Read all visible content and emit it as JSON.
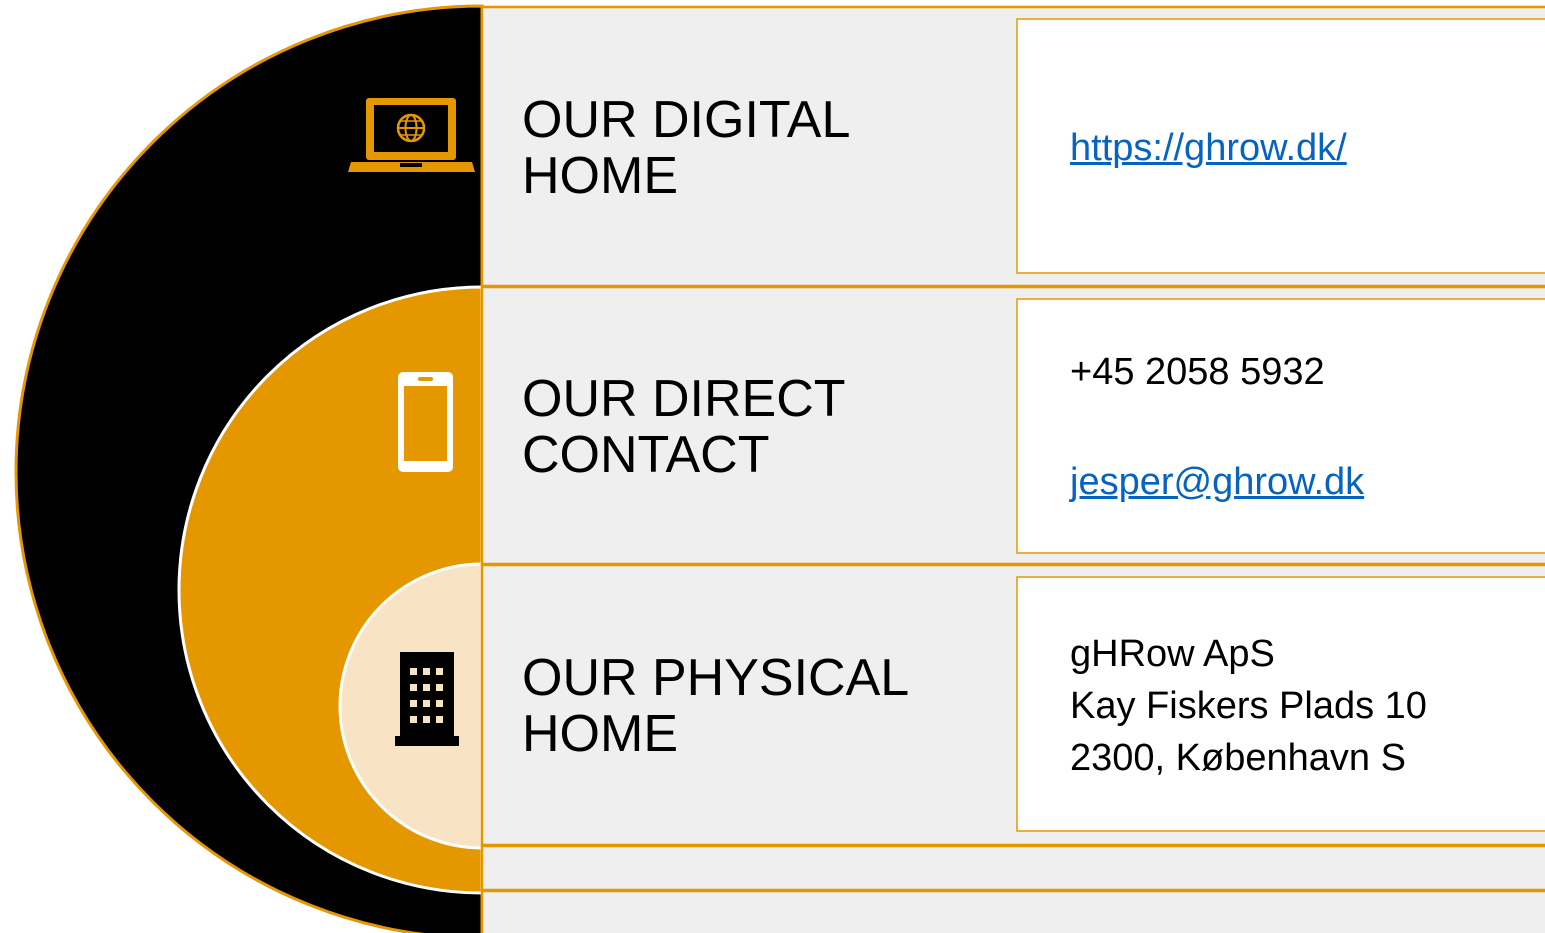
{
  "theme": {
    "orange": "#e59700",
    "dark": "#000000",
    "light": "#f8e4c4",
    "row_bg": "#efefef",
    "cell_bg": "#ffffff",
    "link": "#0563c1"
  },
  "rows": [
    {
      "title_line1": "OUR DIGITAL",
      "title_line2": "HOME",
      "icon": "laptop-globe-icon",
      "link_text": "https://ghrow.dk/"
    },
    {
      "title_line1": "OUR DIRECT",
      "title_line2": "CONTACT",
      "icon": "smartphone-icon",
      "phone": "+45 2058 5932",
      "email": "jesper@ghrow.dk"
    },
    {
      "title_line1": "OUR PHYSICAL",
      "title_line2": "HOME",
      "icon": "office-building-icon",
      "address": [
        "gHRow ApS",
        "Kay Fiskers Plads 10",
        "2300, København  S"
      ]
    }
  ]
}
